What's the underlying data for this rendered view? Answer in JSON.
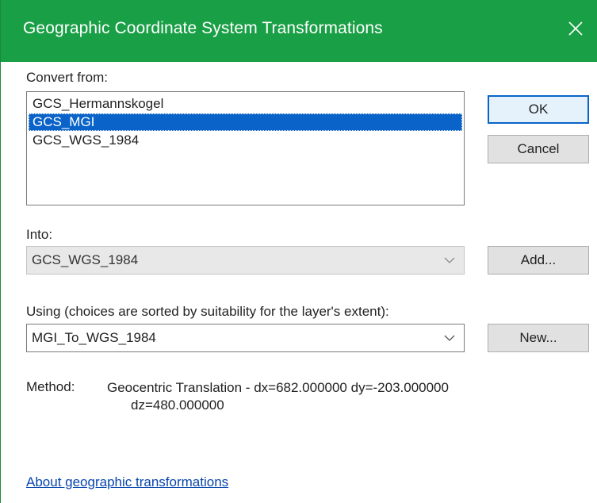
{
  "window": {
    "title": "Geographic Coordinate System Transformations",
    "close_icon": "close-icon"
  },
  "convert_from": {
    "label": "Convert from:",
    "items": [
      "GCS_Hermannskogel",
      "GCS_MGI",
      "GCS_WGS_1984"
    ],
    "selected": "GCS_MGI"
  },
  "buttons": {
    "ok": "OK",
    "cancel": "Cancel",
    "add": "Add...",
    "new": "New..."
  },
  "into": {
    "label": "Into:",
    "value": "GCS_WGS_1984"
  },
  "using": {
    "label": "Using (choices are sorted by suitability for the layer's extent):",
    "value": "MGI_To_WGS_1984"
  },
  "method": {
    "label": "Method:",
    "line1": "Geocentric Translation - dx=682.000000 dy=-203.000000",
    "line2": "dz=480.000000"
  },
  "link": {
    "text": "About geographic transformations"
  },
  "colors": {
    "titlebar": "#199f45",
    "selection": "#0a63c9",
    "link": "#0645ad"
  }
}
